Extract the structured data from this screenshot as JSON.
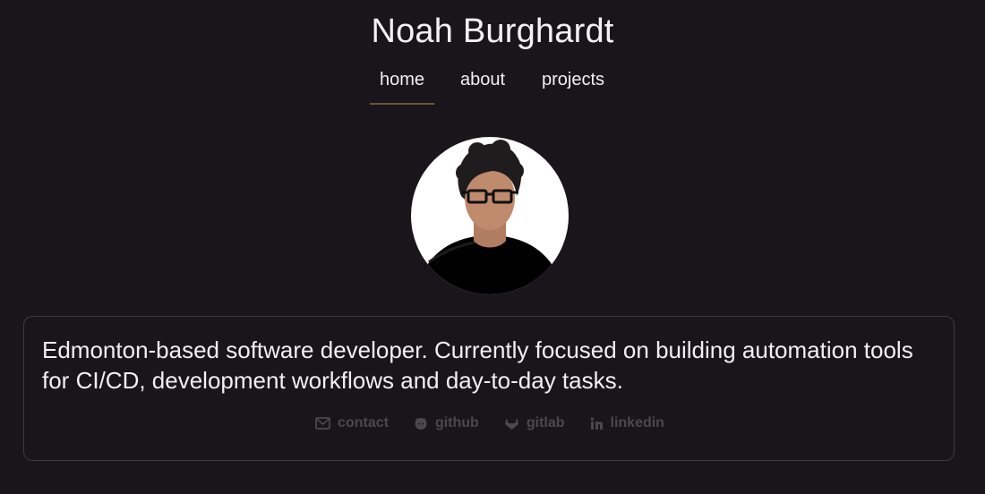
{
  "header": {
    "title": "Noah Burghardt"
  },
  "nav": {
    "items": [
      {
        "label": "home",
        "active": true
      },
      {
        "label": "about",
        "active": false
      },
      {
        "label": "projects",
        "active": false
      }
    ]
  },
  "profile": {
    "avatar_description": "illustrated-portrait-avatar"
  },
  "bio": {
    "text": "Edmonton-based software developer. Currently focused on building automation tools for CI/CD, development workflows and day-to-day tasks."
  },
  "social": {
    "links": [
      {
        "label": "contact",
        "icon": "envelope-icon"
      },
      {
        "label": "github",
        "icon": "github-icon"
      },
      {
        "label": "gitlab",
        "icon": "gitlab-icon"
      },
      {
        "label": "linkedin",
        "icon": "linkedin-icon"
      }
    ]
  },
  "colors": {
    "background": "#18161b",
    "accent_underline": "#6b5638",
    "muted_link": "#4a484d"
  }
}
